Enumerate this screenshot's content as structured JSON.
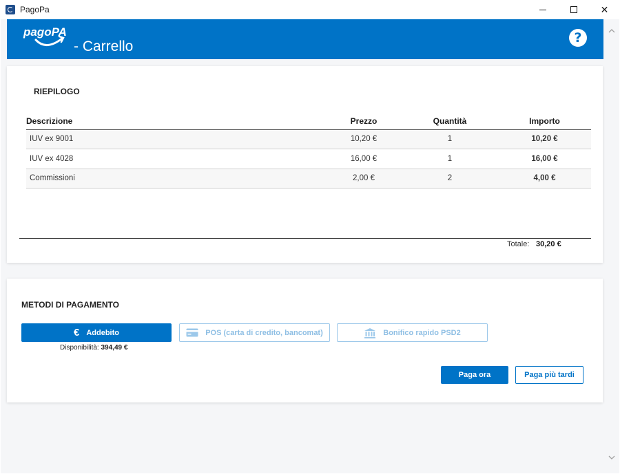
{
  "window": {
    "title": "PagoPa",
    "controls": {
      "minimize": "minimize",
      "maximize": "maximize",
      "close": "✕"
    }
  },
  "header": {
    "logo_text": "pagoPA",
    "title": "- Carrello",
    "help_symbol": "?"
  },
  "summary": {
    "title": "RIEPILOGO",
    "columns": [
      "Descrizione",
      "Prezzo",
      "Quantità",
      "Importo"
    ],
    "rows": [
      {
        "description": "IUV ex 9001",
        "price": "10,20 €",
        "quantity": "1",
        "amount": "10,20 €"
      },
      {
        "description": "IUV ex 4028",
        "price": "16,00 €",
        "quantity": "1",
        "amount": "16,00 €"
      },
      {
        "description": "Commissioni",
        "price": "2,00 €",
        "quantity": "2",
        "amount": "4,00 €"
      }
    ],
    "total_label": "Totale:",
    "total_value": "30,20 €"
  },
  "methods": {
    "title": "METODI DI PAGAMENTO",
    "options": [
      {
        "label": "Addebito",
        "icon": "euro-icon",
        "selected": true
      },
      {
        "label": "POS (carta di credito, bancomat)",
        "icon": "credit-card-icon",
        "selected": false
      },
      {
        "label": "Bonifico rapido PSD2",
        "icon": "bank-icon",
        "selected": false
      }
    ],
    "availability_label": "Disponibilità:",
    "availability_value": "394,49 €"
  },
  "actions": {
    "pay_now": "Paga ora",
    "pay_later": "Paga più tardi"
  },
  "colors": {
    "brand": "#0073c7",
    "disabled_text": "#8fbfe4",
    "background": "#f5f6f8"
  }
}
